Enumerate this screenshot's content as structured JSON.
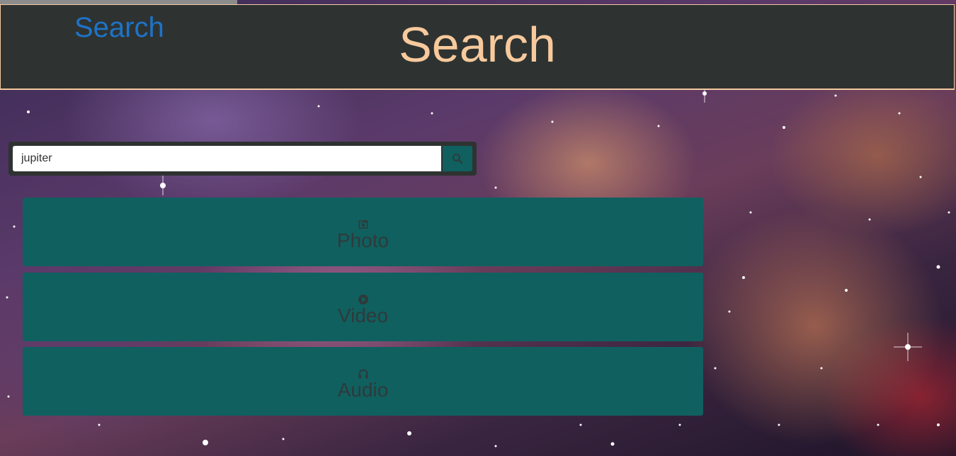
{
  "header": {
    "brand_label": "Search",
    "title": "Search"
  },
  "search": {
    "value": "jupiter",
    "button_icon": "search-icon"
  },
  "media_buttons": [
    {
      "label": "Photo",
      "icon": "photo-icon"
    },
    {
      "label": "Video",
      "icon": "play-circle-icon"
    },
    {
      "label": "Audio",
      "icon": "headphones-icon"
    }
  ],
  "colors": {
    "header_bg": "#2e3331",
    "header_border": "#f5c9a0",
    "brand": "#1e73c8",
    "title": "#f7c99c",
    "button_bg": "#106060",
    "button_text": "#2f3a3a"
  }
}
